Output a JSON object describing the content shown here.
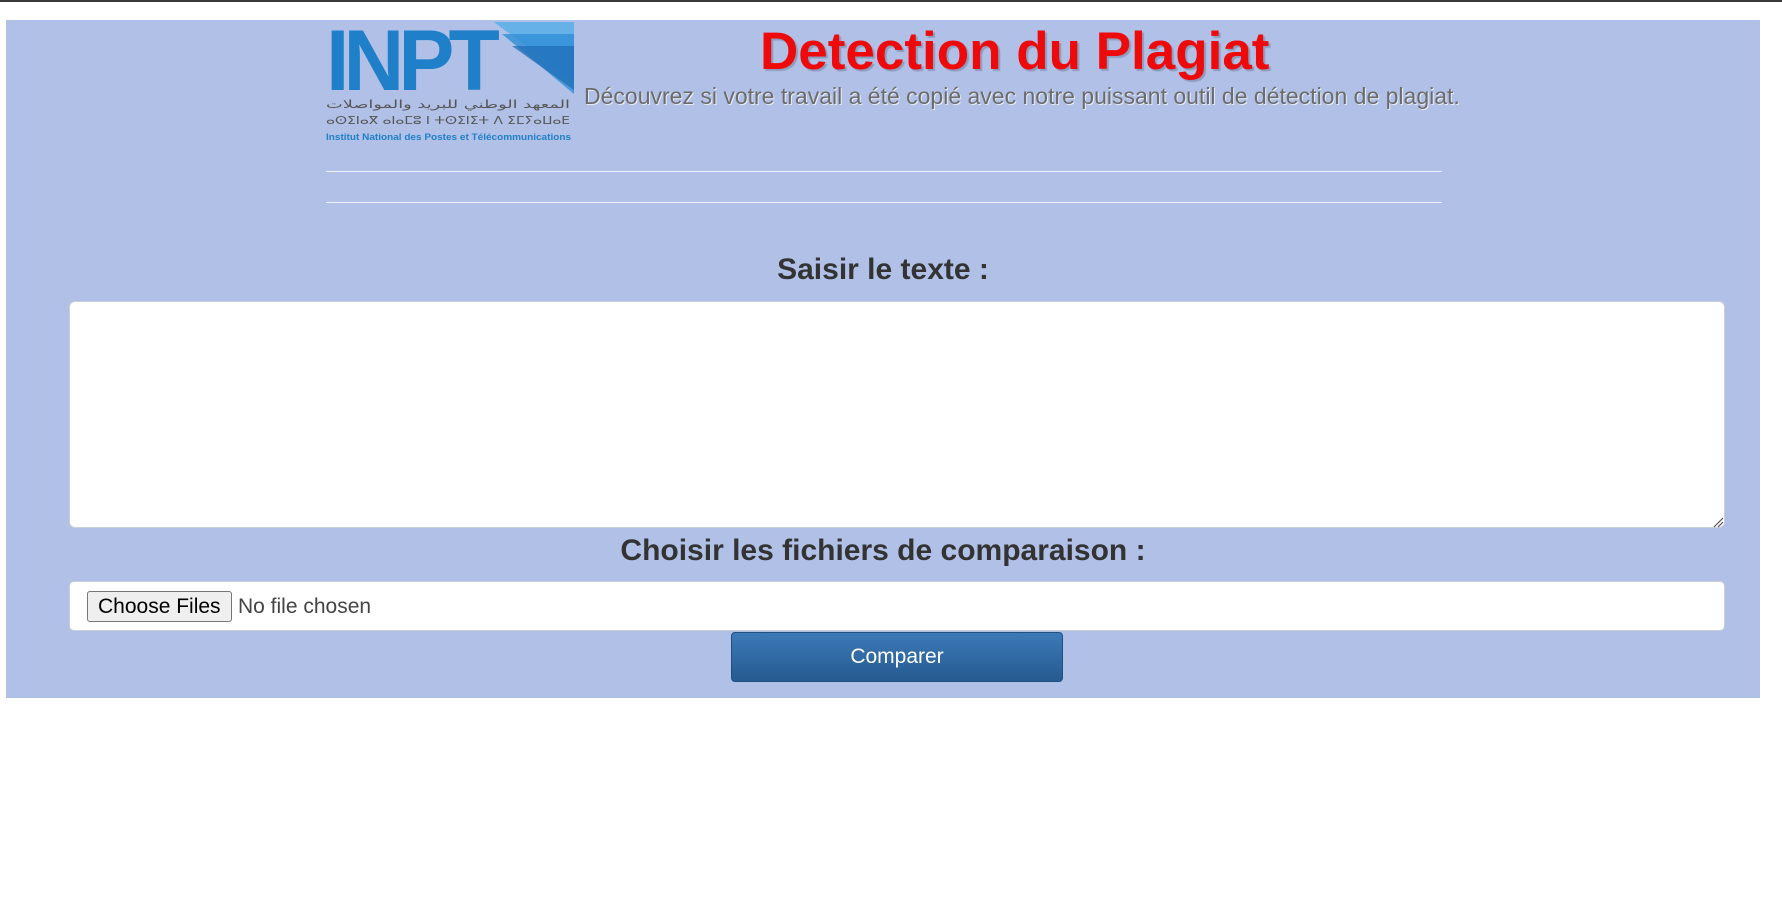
{
  "header": {
    "logo_text": "INPT",
    "logo_arabic": "المعهد الوطني للبريد والمواصلات",
    "logo_tifinagh": "ⴰⵙⵉⵏⴰⴳ ⴰⵏⴰⵎⵓ ⵏ ⵜⵙⵉⵏⵉⵜ ⴷ ⵉⵎⵢⴰⵡⴰⴹ",
    "logo_caption": "Institut National des Postes et Télécommunications",
    "title": "Detection du Plagiat",
    "subtitle": "Découvrez si votre travail a été copié avec notre puissant outil de détection de plagiat."
  },
  "form": {
    "text_label": "Saisir le texte :",
    "text_value": "",
    "files_label": "Choisir les fichiers de comparaison :",
    "choose_files_label": "Choose Files",
    "file_status": "No file chosen",
    "compare_label": "Comparer"
  },
  "colors": {
    "panel_background": "#b0c0e6",
    "title": "#ee0a0a",
    "logo_blue": "#1f7fc8",
    "button": "#2f6ba6"
  }
}
